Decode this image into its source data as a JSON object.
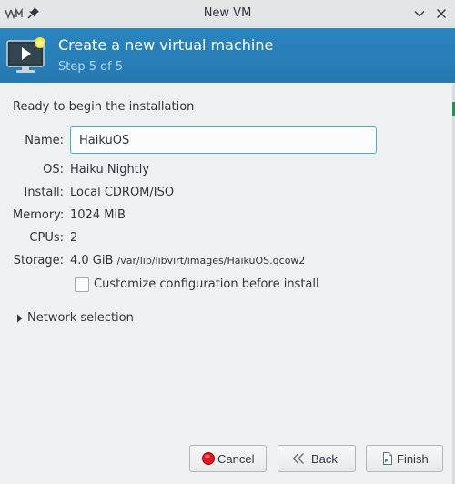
{
  "window": {
    "title": "New VM"
  },
  "header": {
    "title": "Create a new virtual machine",
    "step": "Step 5 of 5"
  },
  "summary": {
    "intro": "Ready to begin the installation",
    "name_label": "Name:",
    "name_value": "HaikuOS",
    "os_label": "OS:",
    "os_value": "Haiku Nightly",
    "install_label": "Install:",
    "install_value": "Local CDROM/ISO",
    "memory_label": "Memory:",
    "memory_value": "1024 MiB",
    "cpus_label": "CPUs:",
    "cpus_value": "2",
    "storage_label": "Storage:",
    "storage_size": "4.0 GiB",
    "storage_path": "/var/lib/libvirt/images/HaikuOS.qcow2",
    "customize_label": "Customize configuration before install",
    "customize_checked": false
  },
  "network": {
    "expander_label": "Network selection",
    "expanded": false
  },
  "buttons": {
    "cancel": "Cancel",
    "back": "Back",
    "finish": "Finish"
  },
  "colors": {
    "banner": "#2980b9",
    "focus_border": "#3daee9",
    "cancel_icon": "#e0141c"
  },
  "icons": {
    "app": "virt-manager-icon",
    "pin": "pin-icon",
    "vm": "vm-monitor-icon",
    "minimize": "chevron-down-icon",
    "close": "close-icon",
    "cancel": "cancel-circle-icon",
    "back": "back-arrow-icon",
    "finish": "finish-document-icon",
    "expander": "triangle-right-icon"
  }
}
